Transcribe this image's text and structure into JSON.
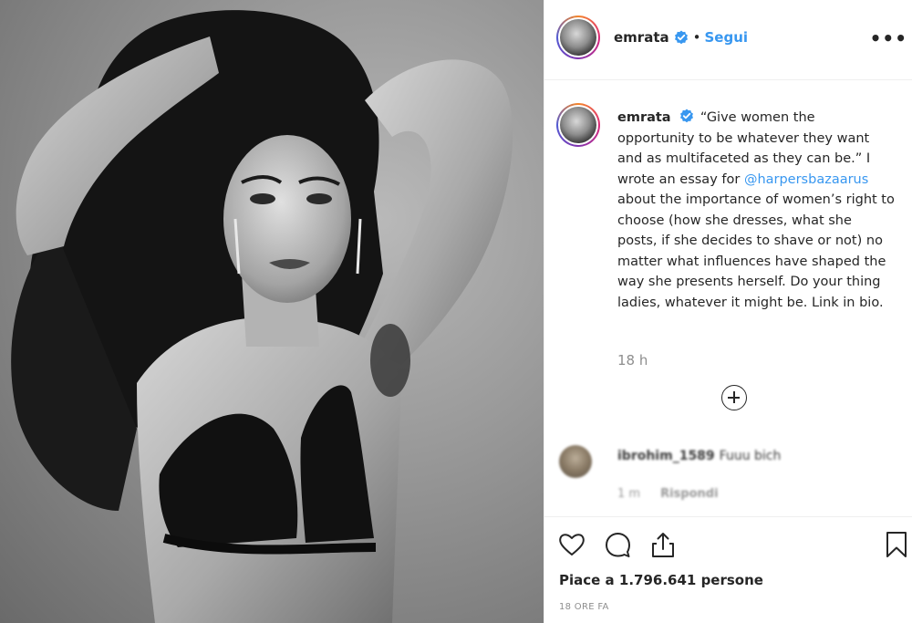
{
  "post": {
    "photo_alt": "",
    "header": {
      "username": "emrata",
      "separator": "•",
      "follow_label": "Segui",
      "more_label": "•••"
    },
    "caption": {
      "username": "emrata",
      "text_before_mention": "“Give women the opportunity to be whatever they want and as multifaceted as they can be.” I wrote an essay for ",
      "mention": "@harpersbazaarus",
      "text_after_mention": " about the importance of women’s right to choose (how she dresses, what she posts, if she decides to shave or not) no matter what influences have shaped the way she presents herself. Do your thing ladies, whatever it might be. Link in bio.",
      "time": "18 h"
    },
    "comment": {
      "username": "ibrohim_1589",
      "text": "Fuuu bich",
      "time": "1 m",
      "reply_label": "Rispondi"
    },
    "likes_text": "Piace a 1.796.641 persone",
    "posted_ago": "18 ORE FA"
  },
  "icons": {
    "verified": "verified-badge-icon",
    "like": "heart-icon",
    "comment": "comment-bubble-icon",
    "share": "share-icon",
    "save": "bookmark-icon",
    "load_more": "plus-circle-icon"
  },
  "colors": {
    "link_blue": "#3897f0",
    "text": "#262626",
    "muted": "#8e8e8e",
    "border": "#efefef"
  }
}
